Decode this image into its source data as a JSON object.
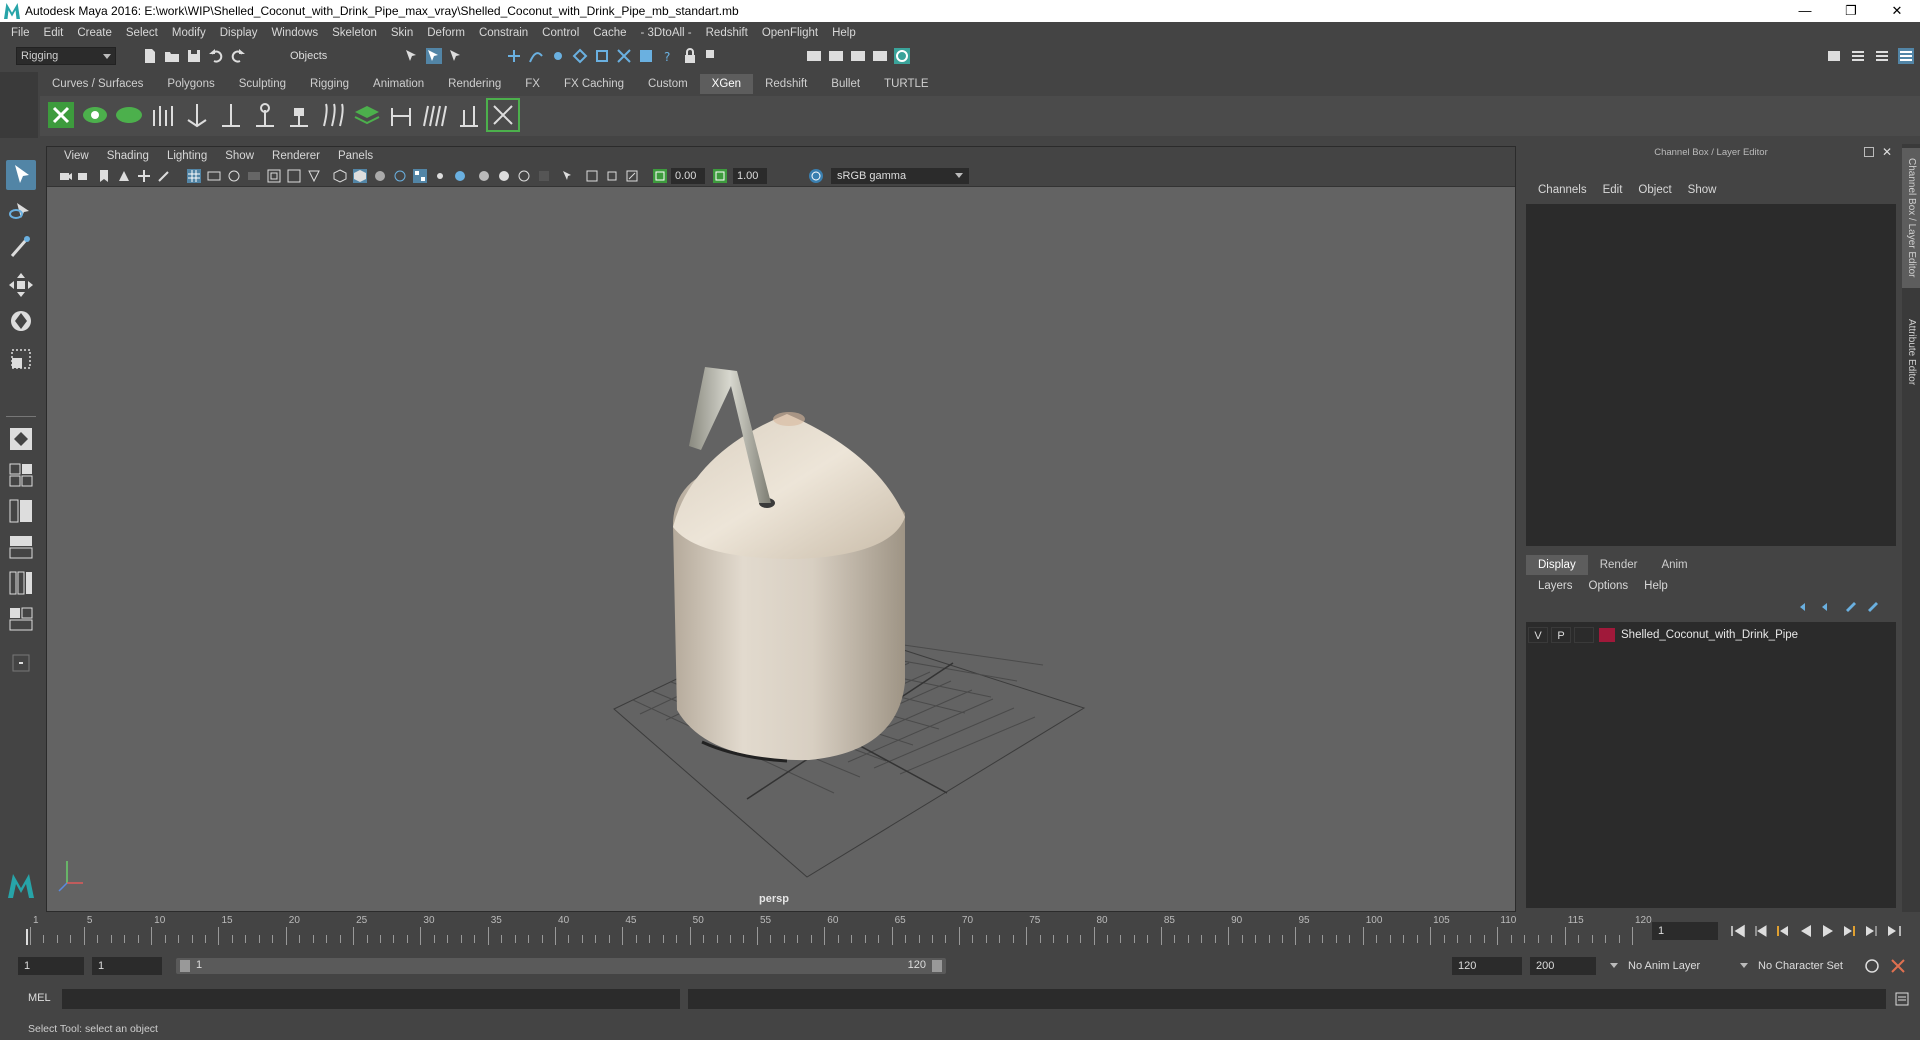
{
  "window": {
    "title": "Autodesk Maya 2016: E:\\work\\WIP\\Shelled_Coconut_with_Drink_Pipe_max_vray\\Shelled_Coconut_with_Drink_Pipe_mb_standart.mb",
    "minimize": "—",
    "restore": "❐",
    "close": "✕"
  },
  "menubar": [
    "File",
    "Edit",
    "Create",
    "Select",
    "Modify",
    "Display",
    "Windows",
    "Skeleton",
    "Skin",
    "Deform",
    "Constrain",
    "Control",
    "Cache",
    "- 3DtoAll -",
    "Redshift",
    "OpenFlight",
    "Help"
  ],
  "statusline": {
    "mode": "Rigging",
    "selection_mask": "Objects"
  },
  "shelf": {
    "tabs": [
      "Curves / Surfaces",
      "Polygons",
      "Sculpting",
      "Rigging",
      "Animation",
      "Rendering",
      "FX",
      "FX Caching",
      "Custom",
      "XGen",
      "Redshift",
      "Bullet",
      "TURTLE"
    ],
    "active_tab": "XGen"
  },
  "viewport": {
    "menu": [
      "View",
      "Shading",
      "Lighting",
      "Show",
      "Renderer",
      "Panels"
    ],
    "exposure": "0.00",
    "gamma": "1.00",
    "color_space": "sRGB gamma",
    "camera": "persp"
  },
  "channel_box": {
    "title": "Channel Box / Layer Editor",
    "menu": [
      "Channels",
      "Edit",
      "Object",
      "Show"
    ]
  },
  "layer_editor": {
    "tabs": [
      "Display",
      "Render",
      "Anim"
    ],
    "active_tab": "Display",
    "menu": [
      "Layers",
      "Options",
      "Help"
    ],
    "layers": [
      {
        "visible": "V",
        "playback": "P",
        "name": "Shelled_Coconut_with_Drink_Pipe",
        "color": "#a0193a"
      }
    ]
  },
  "side_tabs": [
    "Channel Box / Layer Editor",
    "Attribute Editor"
  ],
  "timeline": {
    "ticks": [
      1,
      5,
      10,
      15,
      20,
      25,
      30,
      35,
      40,
      45,
      50,
      55,
      60,
      65,
      70,
      75,
      80,
      85,
      90,
      95,
      100,
      105,
      110,
      115,
      120
    ],
    "current_frame": "1"
  },
  "range": {
    "start_frame": "1",
    "playback_start": "1",
    "slider_start": "1",
    "slider_end": "120",
    "playback_end": "120",
    "end_frame": "200",
    "anim_layer": "No Anim Layer",
    "character_set": "No Character Set"
  },
  "command_line": {
    "label": "MEL"
  },
  "help_line": "Select Tool: select an object"
}
